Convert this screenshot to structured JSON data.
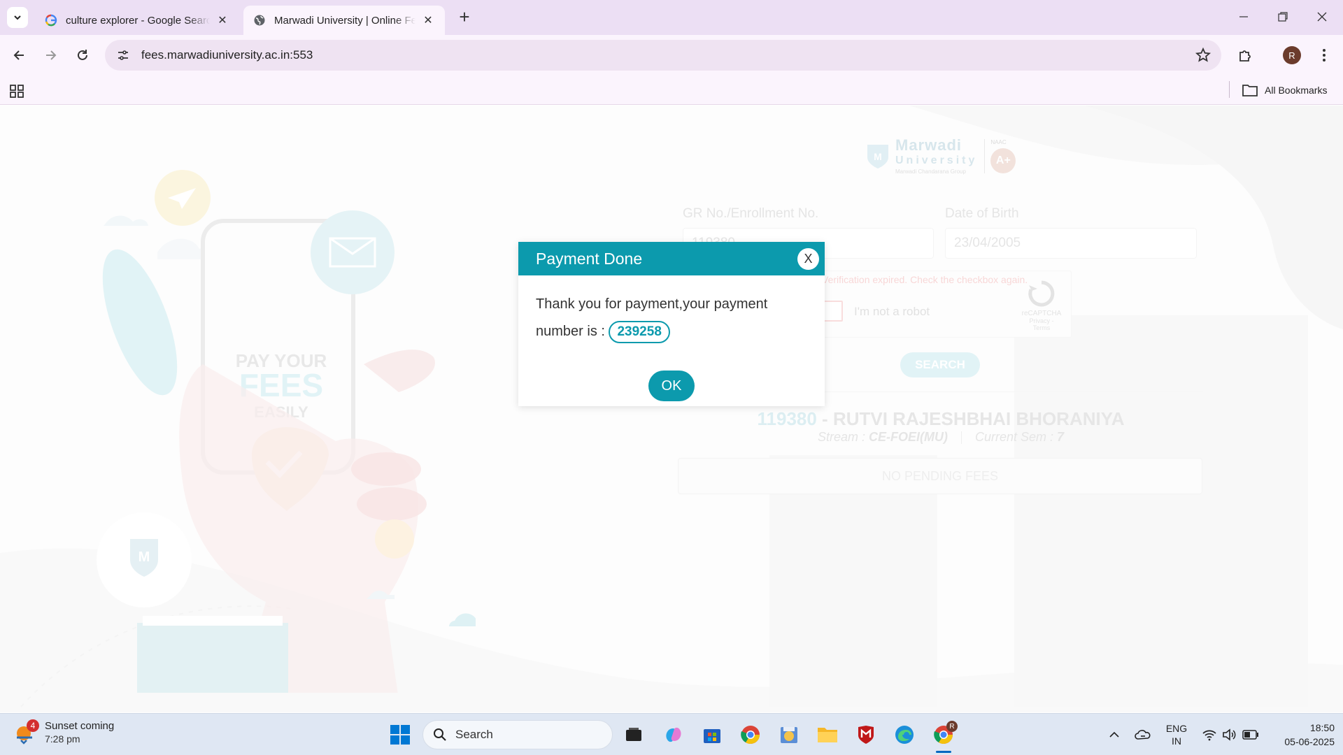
{
  "browser": {
    "tabs": [
      {
        "title": "culture explorer - Google Search",
        "active": false
      },
      {
        "title": "Marwadi University | Online Fees",
        "active": true
      }
    ],
    "url": "fees.marwadiuniversity.ac.in:553",
    "profile_initial": "R",
    "all_bookmarks_label": "All Bookmarks"
  },
  "page": {
    "logo": {
      "line1": "Marwadi",
      "line2": "University",
      "tagline": "Marwadi Chandarana Group",
      "naac_label": "NAAC",
      "grade": "A+"
    },
    "illustration": {
      "line1": "PAY YOUR",
      "line2": "FEES",
      "line3": "EASILY"
    },
    "form": {
      "gr_label": "GR No./Enrollment No.",
      "gr_value": "119380",
      "dob_label": "Date of Birth",
      "dob_value": "23/04/2005",
      "captcha_error": "Verification expired. Check the checkbox again.",
      "captcha_label": "I'm not a robot",
      "captcha_brand": "reCAPTCHA",
      "captcha_links": "Privacy - Terms",
      "search_label": "SEARCH"
    },
    "student": {
      "enrollment": "119380",
      "separator": " - ",
      "name": "RUTVI RAJESHBHAI BHORANIYA",
      "stream_label": "Stream : ",
      "stream_value": "CE-FOEI(MU)",
      "sem_label": "Current Sem : ",
      "sem_value": "7",
      "pending_status": "NO PENDING FEES"
    }
  },
  "modal": {
    "title": "Payment Done",
    "close_label": "X",
    "message_line1": "Thank you for payment,your payment",
    "message_line2": "number is : ",
    "payment_number": "239258",
    "ok_label": "OK",
    "accent_color": "#0c9aad"
  },
  "taskbar": {
    "weather_title": "Sunset coming",
    "weather_time": "7:28 pm",
    "weather_badge": "4",
    "search_placeholder": "Search",
    "lang_line1": "ENG",
    "lang_line2": "IN",
    "time": "18:50",
    "date": "05-06-2025",
    "chrome_badge": "R"
  }
}
